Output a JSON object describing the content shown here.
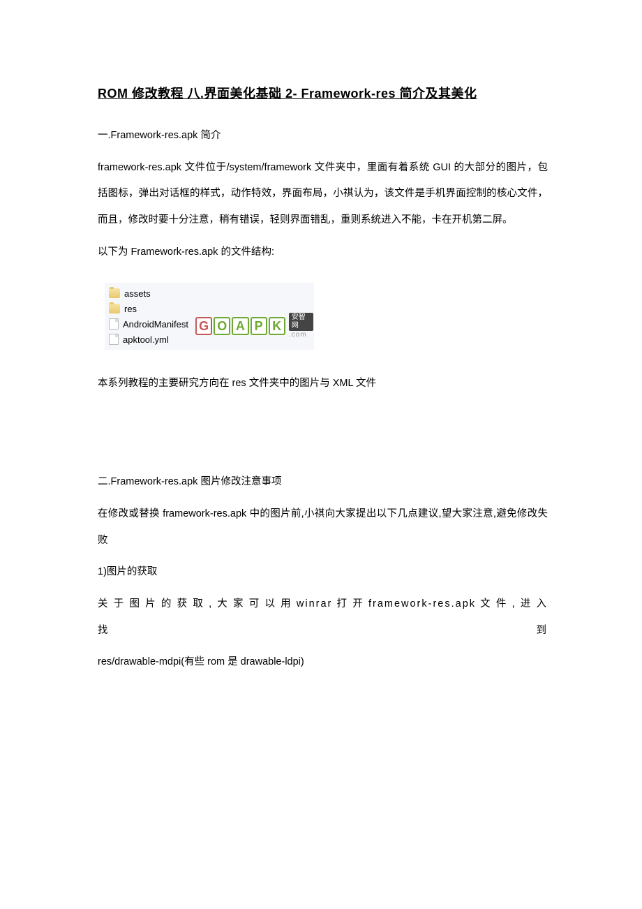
{
  "title": "ROM 修改教程  八.界面美化基础 2- Framework-res 简介及其美化",
  "section1": {
    "header": "一.Framework-res.apk 简介",
    "p1": "framework-res.apk 文件位于/system/framework 文件夹中，里面有着系统 GUI 的大部分的图片，包括图标，弹出对话框的样式，动作特效，界面布局，小祺认为，该文件是手机界面控制的核心文件，而且，修改时要十分注意，稍有错误，轻则界面错乱，重则系统进入不能，卡在开机第二屏。",
    "p2": "以下为 Framework-res.apk 的文件结构:",
    "files": [
      "assets",
      "res",
      "AndroidManifest",
      "apktool.yml"
    ],
    "p3": "本系列教程的主要研究方向在 res 文件夹中的图片与 XML 文件"
  },
  "section2": {
    "header": "二.Framework-res.apk 图片修改注意事项",
    "p1": "在修改或替换 framework-res.apk 中的图片前,小祺向大家提出以下几点建议,望大家注意,避免修改失败",
    "sub1": "1)图片的获取",
    "p2": "关 于 图 片 的 获 取 , 大 家 可 以 用  winrar  打 开  framework-res.apk  文 件 , 进 入 找 到",
    "p3": "res/drawable-mdpi(有些 rom 是 drawable-ldpi)"
  },
  "watermark": {
    "g": "G",
    "o": "O",
    "a": "A",
    "p": "P",
    "k": "K",
    "cn": "安智网",
    "com": ".com"
  }
}
